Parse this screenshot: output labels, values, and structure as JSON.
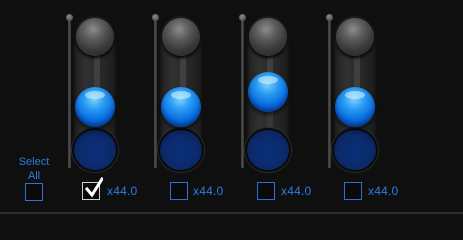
{
  "select_all": {
    "label_line1": "Select",
    "label_line2": "All",
    "checked": false
  },
  "channels": [
    {
      "value_label": "x44.0",
      "checked": true,
      "level": 0.28
    },
    {
      "value_label": "x44.0",
      "checked": false,
      "level": 0.28
    },
    {
      "value_label": "x44.0",
      "checked": false,
      "level": 0.45
    },
    {
      "value_label": "x44.0",
      "checked": false,
      "level": 0.28
    }
  ],
  "colors": {
    "accent": "#2b7de0",
    "background": "#0f0f0f"
  }
}
